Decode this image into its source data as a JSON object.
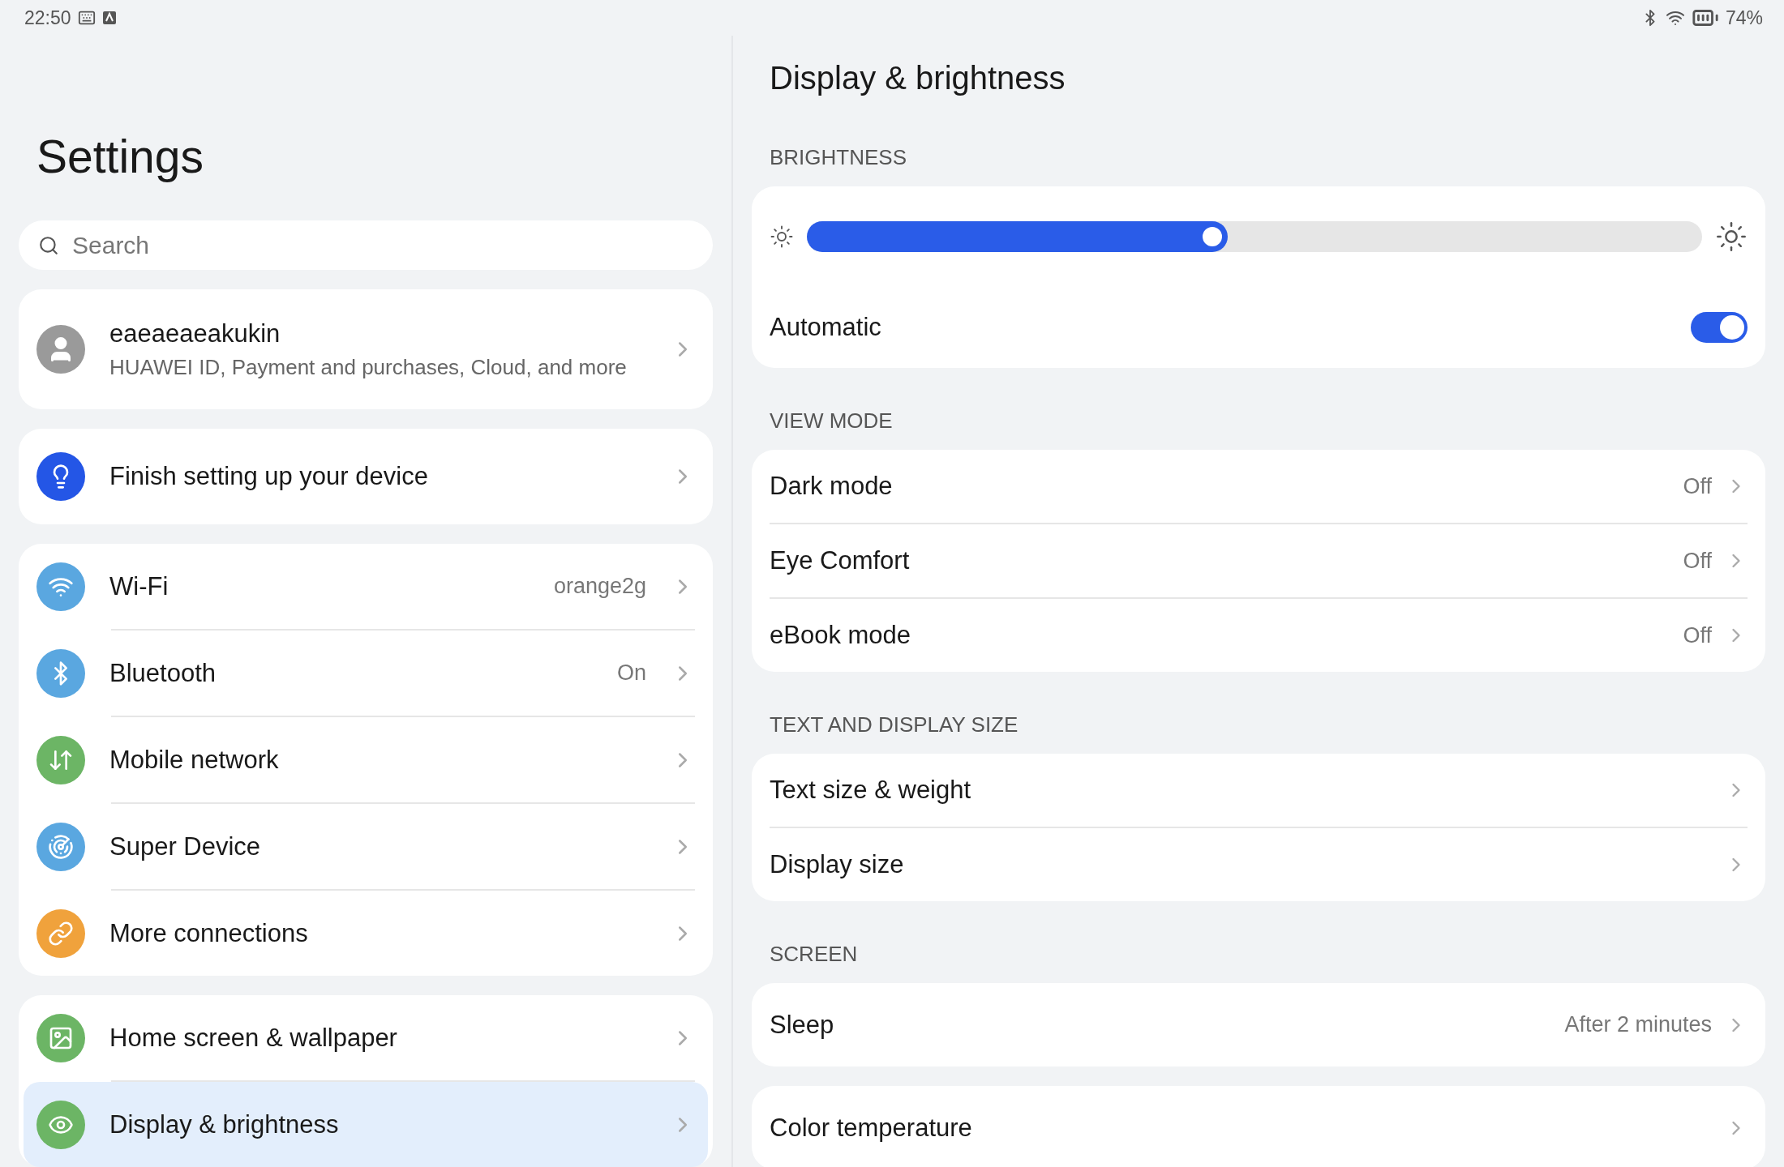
{
  "status_bar": {
    "time": "22:50",
    "battery": "74%"
  },
  "sidebar": {
    "title": "Settings",
    "search": {
      "placeholder": "Search"
    },
    "account": {
      "name": "eaeaeaeakukin",
      "subtitle": "HUAWEI ID, Payment and purchases, Cloud, and more"
    },
    "groups": [
      [
        {
          "label": "Finish setting up your device",
          "selected": false
        }
      ],
      [
        {
          "label": "Wi-Fi",
          "value": "orange2g",
          "selected": false
        },
        {
          "label": "Bluetooth",
          "value": "On",
          "selected": false
        },
        {
          "label": "Mobile network",
          "selected": false
        },
        {
          "label": "Super Device",
          "selected": false
        },
        {
          "label": "More connections",
          "selected": false
        }
      ],
      [
        {
          "label": "Home screen & wallpaper",
          "selected": false
        },
        {
          "label": "Display & brightness",
          "selected": true
        }
      ]
    ]
  },
  "detail": {
    "title": "Display & brightness",
    "sections": [
      {
        "header": "BRIGHTNESS",
        "cards": [
          [
            {
              "kind": "slider",
              "level": 0.47
            },
            {
              "kind": "toggle",
              "label": "Automatic",
              "on": true
            }
          ]
        ]
      },
      {
        "header": "VIEW MODE",
        "cards": [
          [
            {
              "kind": "link",
              "label": "Dark mode",
              "value": "Off"
            },
            {
              "kind": "link",
              "label": "Eye Comfort",
              "value": "Off"
            },
            {
              "kind": "link",
              "label": "eBook mode",
              "value": "Off"
            }
          ]
        ]
      },
      {
        "header": "TEXT AND DISPLAY SIZE",
        "cards": [
          [
            {
              "kind": "link",
              "label": "Text size & weight"
            },
            {
              "kind": "link",
              "label": "Display size"
            }
          ]
        ]
      },
      {
        "header": "SCREEN",
        "cards": [
          [
            {
              "kind": "link",
              "label": "Sleep",
              "value": "After 2 minutes"
            }
          ],
          [
            {
              "kind": "link",
              "label": "Color temperature"
            }
          ]
        ]
      }
    ]
  }
}
